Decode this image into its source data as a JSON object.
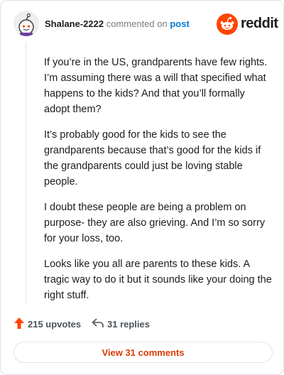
{
  "header": {
    "username": "Shalane-2222",
    "action_text": "commented on",
    "post_link": "post",
    "brand": "reddit"
  },
  "comment": {
    "paragraphs": [
      "If you’re in the US, grandparents have few rights. I’m assuming there was a will that specified what happens to the kids? And that you’ll formally adopt them?",
      "It’s probably good for the kids to see the grandparents because that’s good for the kids if the grandparents could just be loving stable people.",
      "I doubt these people are being a problem on purpose- they are also grieving. And I’m so sorry for your loss, too.",
      "Looks like you all are parents to these kids. A tragic way to do it but it sounds like your doing the right stuff."
    ]
  },
  "actions": {
    "upvotes": "215 upvotes",
    "replies": "31 replies"
  },
  "footer": {
    "view_comments": "View 31 comments"
  },
  "colors": {
    "brand_orange": "#ff4500",
    "link_blue": "#0079d3",
    "button_text": "#d93a00"
  },
  "icons": {
    "avatar": "snoo-avatar-icon",
    "logo": "reddit-logo-icon",
    "upvote": "upvote-arrow-icon",
    "reply": "reply-arrow-icon"
  }
}
